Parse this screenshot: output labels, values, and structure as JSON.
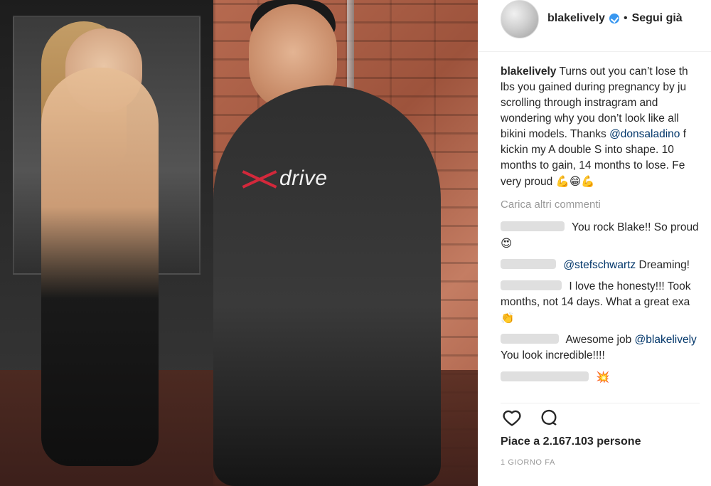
{
  "header": {
    "username": "blakelively",
    "follow_text": "Segui già",
    "dot": "•"
  },
  "caption": {
    "username": "blakelively",
    "text_parts": [
      "Turns out you can’t lose th",
      "lbs you gained during pregnancy by ju",
      "scrolling through instragram and",
      "wondering why you don’t look like all",
      "bikini models. Thanks ",
      "@donsaladino",
      " f",
      "kickin my A double S into shape. 10",
      "months to gain, 14 months to lose. Fe",
      "very proud "
    ],
    "emojis": "💪😁💪"
  },
  "comments": {
    "more_label": "Carica altri commenti",
    "items": [
      {
        "text": "You rock Blake!! So proud",
        "emoji": "😍"
      },
      {
        "mention": "@stefschwartz",
        "text": " Dreaming!"
      },
      {
        "text_1": "I love the honesty!!! Took",
        "text_2": "months, not 14 days. What a great exa",
        "emoji": "👏"
      },
      {
        "text": "Awesome job ",
        "mention": "@blakelively",
        "text_2": "You look incredible!!!!"
      },
      {
        "emoji": "💥"
      }
    ]
  },
  "actions": {
    "likes": "Piace a 2.167.103 persone",
    "time": "1 GIORNO FA"
  },
  "photo": {
    "shirt_logo_text": "drive"
  }
}
